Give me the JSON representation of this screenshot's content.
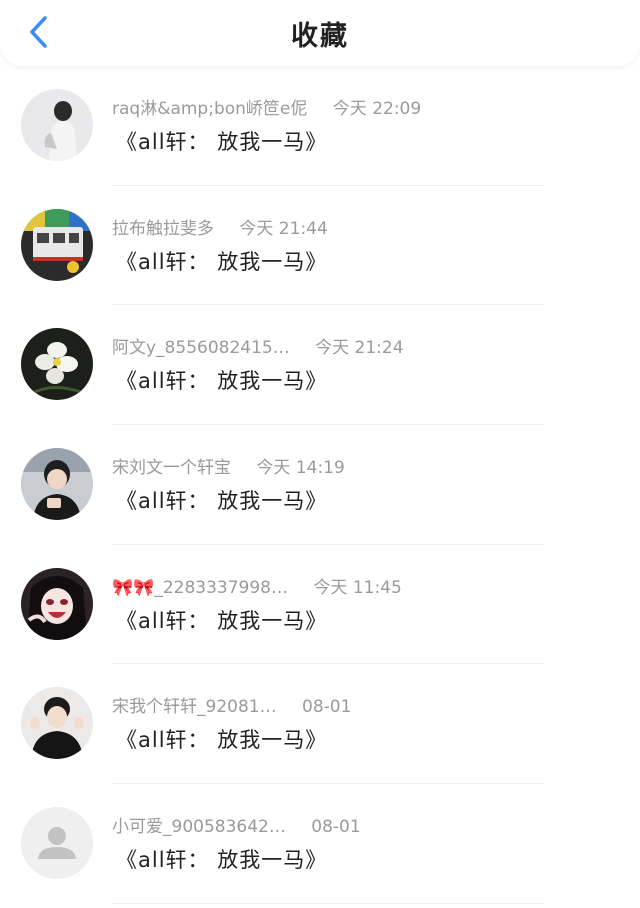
{
  "header": {
    "title": "收藏",
    "back_icon": "chevron-left-icon",
    "accent": "#3d8ef5"
  },
  "items": [
    {
      "name": "raq淋&amp;bon峤笸e伲",
      "time": "今天 22:09",
      "content": "《all轩： 放我一马》",
      "avatar": "avatar-photo-girl"
    },
    {
      "name": "拉布触拉斐多",
      "time": "今天 21:44",
      "content": "《all轩： 放我一马》",
      "avatar": "avatar-photo-train"
    },
    {
      "name": "阿文y_8556082415…",
      "time": "今天 21:24",
      "content": "《all轩： 放我一马》",
      "avatar": "avatar-photo-flower"
    },
    {
      "name": "宋刘文一个轩宝",
      "time": "今天 14:19",
      "content": "《all轩： 放我一马》",
      "avatar": "avatar-photo-boy"
    },
    {
      "name": "🎀🎀_2283337998…",
      "time": "今天 11:45",
      "content": "《all轩： 放我一马》",
      "avatar": "avatar-photo-anime"
    },
    {
      "name": "宋我个轩轩_92081…",
      "time": "08-01",
      "content": "《all轩： 放我一马》",
      "avatar": "avatar-photo-boy2"
    },
    {
      "name": "小可爱_900583642…",
      "time": "08-01",
      "content": "《all轩： 放我一马》",
      "avatar": "default-avatar-icon"
    }
  ]
}
